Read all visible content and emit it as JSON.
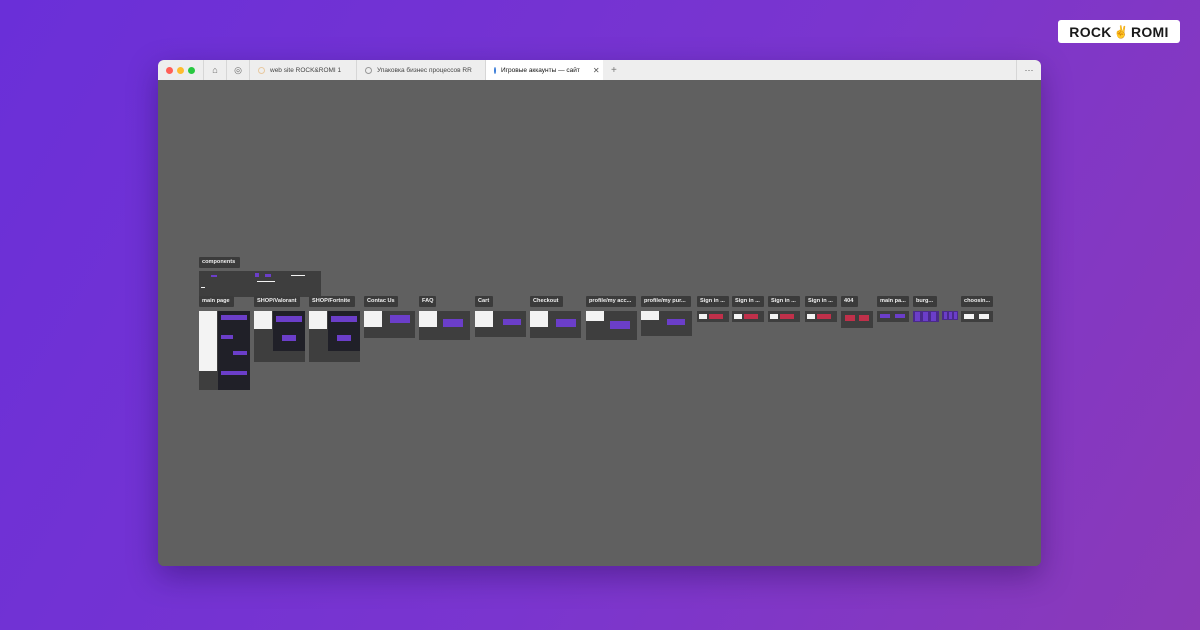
{
  "brand": {
    "left": "ROCK",
    "right": "ROMI"
  },
  "browser": {
    "tabs": [
      {
        "label": "web site ROCK&ROMI 1",
        "active": false
      },
      {
        "label": "Упаковка бизнес процессов RR",
        "active": false
      },
      {
        "label": "Игровые аккаунты — сайт",
        "active": true
      }
    ],
    "new_tab": "+",
    "more": "···"
  },
  "canvas": {
    "frames": [
      {
        "label": "components"
      },
      {
        "label": "main page"
      },
      {
        "label": "SHOP/Valorant"
      },
      {
        "label": "SHOP/Fortnite"
      },
      {
        "label": "Contac Us"
      },
      {
        "label": "FAQ"
      },
      {
        "label": "Cart"
      },
      {
        "label": "Checkout"
      },
      {
        "label": "profile/my acc..."
      },
      {
        "label": "profile/my pur..."
      },
      {
        "label": "Sign in ..."
      },
      {
        "label": "Sign in ..."
      },
      {
        "label": "Sign in ..."
      },
      {
        "label": "Sign in ..."
      },
      {
        "label": "404"
      },
      {
        "label": "main pa..."
      },
      {
        "label": "burg..."
      },
      {
        "label": "choosin..."
      }
    ]
  },
  "colors": {
    "accent": "#6b3ec9",
    "background_start": "#6a2fd8",
    "background_end": "#8b3ab8",
    "canvas": "#606060"
  },
  "icons": {
    "home": "home-icon",
    "globe": "globe-icon",
    "close": "close-icon",
    "more": "more-icon"
  }
}
